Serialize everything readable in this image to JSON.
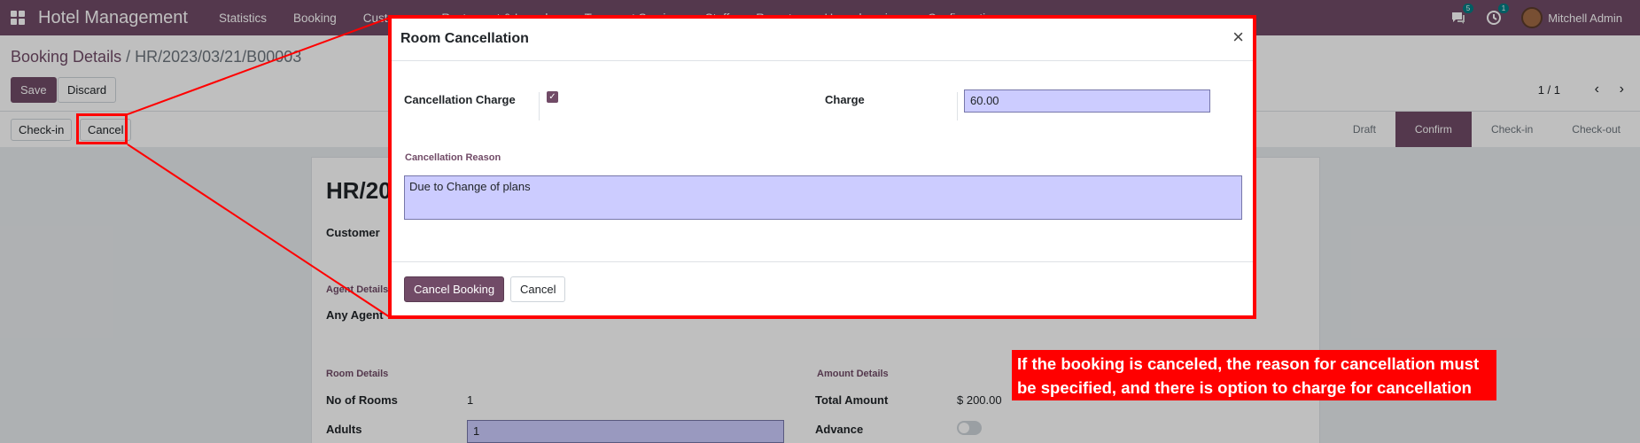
{
  "navbar": {
    "brand": "Hotel Management",
    "menu": [
      "Statistics",
      "Booking",
      "Customer",
      "Restaurant & Laundry",
      "Transport Service",
      "Staff",
      "Reports",
      "Housekeeping",
      "Configuration"
    ],
    "chat_badge": "5",
    "activity_badge": "1",
    "user": "Mitchell Admin"
  },
  "control": {
    "breadcrumb_parent": "Booking Details",
    "breadcrumb_sep": " / ",
    "breadcrumb_current": "HR/2023/03/21/B00003",
    "save_label": "Save",
    "discard_label": "Discard",
    "pager": "1 / 1",
    "pager_prev": "‹",
    "pager_next": "›"
  },
  "statusbar": {
    "checkin_label": "Check-in",
    "cancel_label": "Cancel",
    "stages": [
      "Draft",
      "Confirm",
      "Check-in",
      "Check-out"
    ],
    "active_stage": "Confirm"
  },
  "sheet": {
    "title": "HR/20",
    "customer_label": "Customer",
    "agent_section": "Agent Details",
    "any_agent_label": "Any Agent",
    "room_section": "Room Details",
    "amount_section": "Amount Details",
    "no_rooms_label": "No of Rooms",
    "no_rooms_value": "1",
    "adults_label": "Adults",
    "adults_value": "1",
    "total_label": "Total Amount",
    "total_value": "$ 200.00",
    "advance_label": "Advance"
  },
  "modal": {
    "title": "Room Cancellation",
    "close": "×",
    "charge_flag_label": "Cancellation Charge",
    "charge_flag_checked": true,
    "charge_label": "Charge",
    "charge_value": "60.00",
    "reason_section": "Cancellation Reason",
    "reason_value": "Due to Change of plans",
    "confirm_button": "Cancel Booking",
    "cancel_button": "Cancel"
  },
  "annotation": {
    "text": "If the booking is canceled, the reason for cancellation must be specified, and there is option to  charge for cancellation",
    "color": "#ff0000"
  },
  "colors": {
    "brand": "#714b67",
    "input_bg": "#ccccff"
  }
}
